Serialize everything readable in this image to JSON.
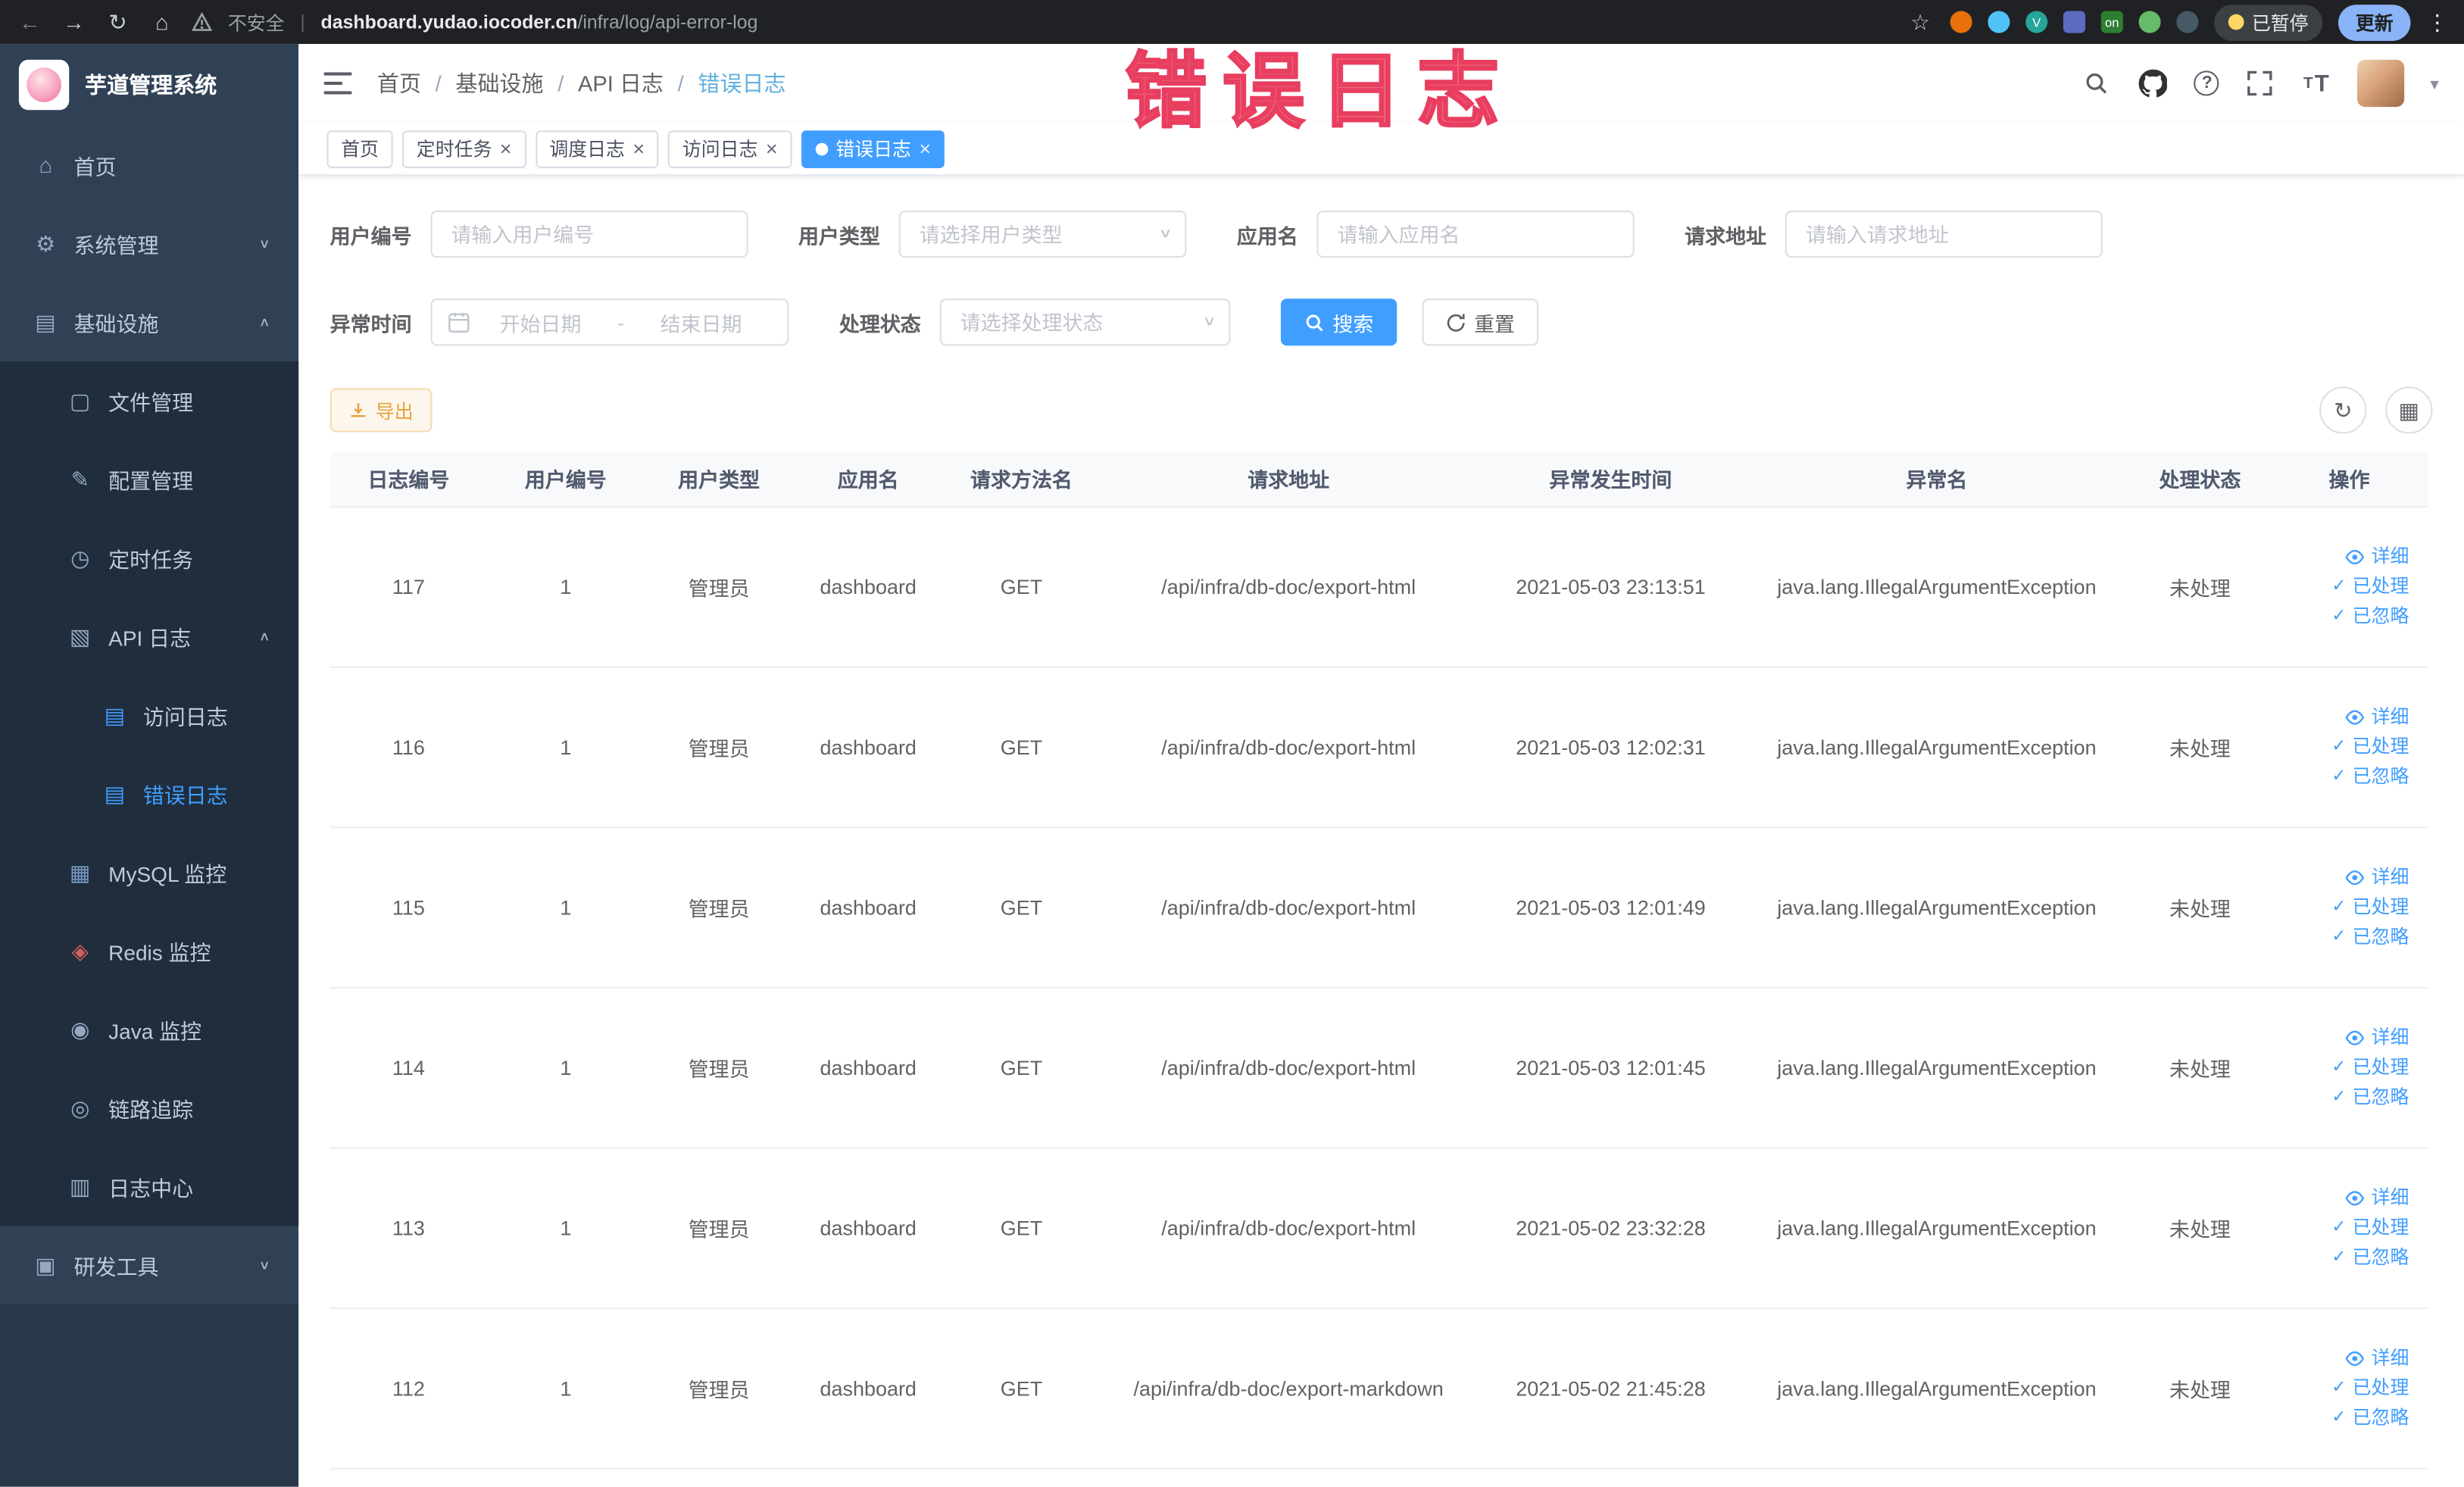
{
  "colors": {
    "accent": "#409eff",
    "warning": "#e6a23c",
    "annotation": "#f16179",
    "sidebar_bg": "#304156",
    "submenu_bg": "#1f2d3d"
  },
  "browser": {
    "security_label": "不安全",
    "url_host": "dashboard.yudao.iocoder.cn",
    "url_path": "/infra/log/api-error-log",
    "paused_badge": "已暂停",
    "update_button": "更新"
  },
  "annotation": {
    "text": "错误日志"
  },
  "sidebar": {
    "app_title": "芋道管理系统",
    "items": [
      {
        "label": "首页",
        "icon": "home-icon",
        "level": 1
      },
      {
        "label": "系统管理",
        "icon": "gear-icon",
        "level": 1,
        "arrow": "down"
      },
      {
        "label": "基础设施",
        "icon": "infra-icon",
        "level": 1,
        "arrow": "up"
      },
      {
        "label": "文件管理",
        "icon": "file-icon",
        "level": 2
      },
      {
        "label": "配置管理",
        "icon": "config-icon",
        "level": 2
      },
      {
        "label": "定时任务",
        "icon": "timer-icon",
        "level": 2
      },
      {
        "label": "API 日志",
        "icon": "api-log-icon",
        "level": 2,
        "arrow": "up"
      },
      {
        "label": "访问日志",
        "icon": "access-log-icon",
        "level": 3,
        "icon_color": "#409eff"
      },
      {
        "label": "错误日志",
        "icon": "error-log-icon",
        "level": 3,
        "active": true,
        "icon_color": "#409eff"
      },
      {
        "label": "MySQL 监控",
        "icon": "mysql-icon",
        "level": 2,
        "icon_color": "#7a9cc6"
      },
      {
        "label": "Redis 监控",
        "icon": "redis-icon",
        "level": 2,
        "icon_color": "#d0605a"
      },
      {
        "label": "Java 监控",
        "icon": "java-icon",
        "level": 2
      },
      {
        "label": "链路追踪",
        "icon": "trace-icon",
        "level": 2
      },
      {
        "label": "日志中心",
        "icon": "log-center-icon",
        "level": 2
      },
      {
        "label": "研发工具",
        "icon": "tools-icon",
        "level": 1,
        "arrow": "down"
      }
    ]
  },
  "header": {
    "breadcrumb": [
      {
        "label": "首页"
      },
      {
        "label": "基础设施"
      },
      {
        "label": "API 日志"
      },
      {
        "label": "错误日志"
      }
    ]
  },
  "tags": [
    {
      "label": "首页",
      "closable": false,
      "active": false
    },
    {
      "label": "定时任务",
      "closable": true,
      "active": false
    },
    {
      "label": "调度日志",
      "closable": true,
      "active": false
    },
    {
      "label": "访问日志",
      "closable": true,
      "active": false
    },
    {
      "label": "错误日志",
      "closable": true,
      "active": true
    }
  ],
  "filters": {
    "user_id": {
      "label": "用户编号",
      "placeholder": "请输入用户编号"
    },
    "user_type": {
      "label": "用户类型",
      "placeholder": "请选择用户类型"
    },
    "app_name": {
      "label": "应用名",
      "placeholder": "请输入应用名"
    },
    "request_url": {
      "label": "请求地址",
      "placeholder": "请输入请求地址"
    },
    "exception_time": {
      "label": "异常时间",
      "start_placeholder": "开始日期",
      "separator": "-",
      "end_placeholder": "结束日期"
    },
    "process_status": {
      "label": "处理状态",
      "placeholder": "请选择处理状态"
    },
    "search_button": "搜索",
    "reset_button": "重置"
  },
  "toolbar": {
    "export_button": "导出"
  },
  "table": {
    "columns": [
      {
        "key": "id",
        "label": "日志编号"
      },
      {
        "key": "user_id",
        "label": "用户编号"
      },
      {
        "key": "user_type",
        "label": "用户类型"
      },
      {
        "key": "app_name",
        "label": "应用名"
      },
      {
        "key": "method",
        "label": "请求方法名"
      },
      {
        "key": "url",
        "label": "请求地址"
      },
      {
        "key": "time",
        "label": "异常发生时间"
      },
      {
        "key": "exception",
        "label": "异常名"
      },
      {
        "key": "status",
        "label": "处理状态"
      },
      {
        "key": "actions",
        "label": "操作"
      }
    ],
    "action_labels": {
      "detail": "详细",
      "processed": "已处理",
      "ignored": "已忽略"
    },
    "rows": [
      {
        "id": "117",
        "user_id": "1",
        "user_type": "管理员",
        "app_name": "dashboard",
        "method": "GET",
        "url": "/api/infra/db-doc/export-html",
        "time": "2021-05-03 23:13:51",
        "exception": "java.lang.IllegalArgumentException",
        "status": "未处理"
      },
      {
        "id": "116",
        "user_id": "1",
        "user_type": "管理员",
        "app_name": "dashboard",
        "method": "GET",
        "url": "/api/infra/db-doc/export-html",
        "time": "2021-05-03 12:02:31",
        "exception": "java.lang.IllegalArgumentException",
        "status": "未处理"
      },
      {
        "id": "115",
        "user_id": "1",
        "user_type": "管理员",
        "app_name": "dashboard",
        "method": "GET",
        "url": "/api/infra/db-doc/export-html",
        "time": "2021-05-03 12:01:49",
        "exception": "java.lang.IllegalArgumentException",
        "status": "未处理"
      },
      {
        "id": "114",
        "user_id": "1",
        "user_type": "管理员",
        "app_name": "dashboard",
        "method": "GET",
        "url": "/api/infra/db-doc/export-html",
        "time": "2021-05-03 12:01:45",
        "exception": "java.lang.IllegalArgumentException",
        "status": "未处理"
      },
      {
        "id": "113",
        "user_id": "1",
        "user_type": "管理员",
        "app_name": "dashboard",
        "method": "GET",
        "url": "/api/infra/db-doc/export-html",
        "time": "2021-05-02 23:32:28",
        "exception": "java.lang.IllegalArgumentException",
        "status": "未处理"
      },
      {
        "id": "112",
        "user_id": "1",
        "user_type": "管理员",
        "app_name": "dashboard",
        "method": "GET",
        "url": "/api/infra/db-doc/export-markdown",
        "time": "2021-05-02 21:45:28",
        "exception": "java.lang.IllegalArgumentException",
        "status": "未处理"
      }
    ]
  }
}
